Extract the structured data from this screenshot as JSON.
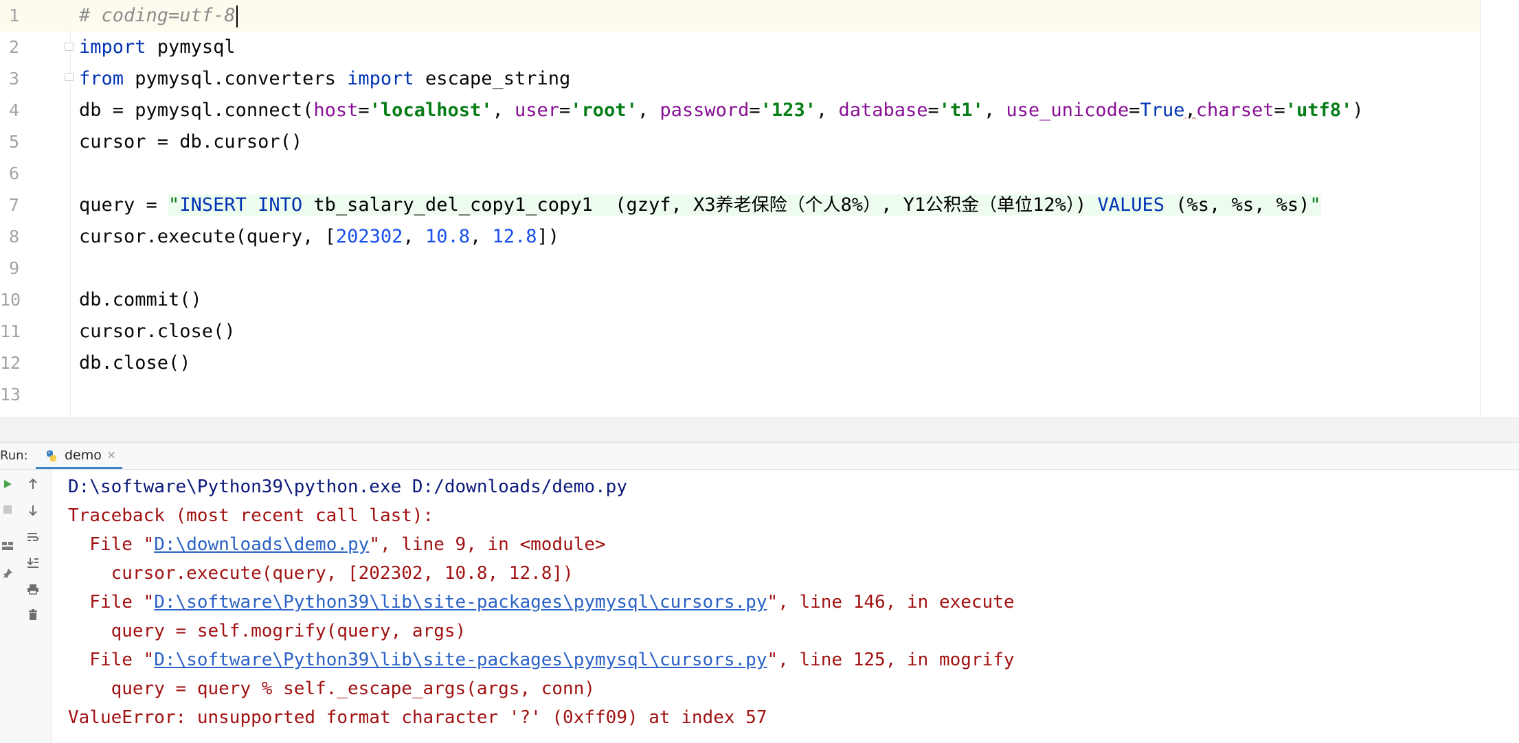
{
  "editor": {
    "lines": [
      {
        "no": "1",
        "comment": "# coding=utf-8"
      },
      {
        "no": "2",
        "kw": "import",
        "rest": " pymysql"
      },
      {
        "no": "3",
        "kw1": "from",
        "mid": " pymysql.converters ",
        "kw2": "import",
        "rest": " escape_string"
      },
      {
        "no": "4",
        "pre": "db = pymysql.connect(",
        "k_host": "host",
        "eq": "=",
        "v_host": "'localhost'",
        "sep": ", ",
        "k_user": "user",
        "v_user": "'root'",
        "k_password": "password",
        "v_password": "'123'",
        "k_database": "database",
        "v_database": "'t1'",
        "k_use_unicode": "use_unicode",
        "v_true": "True",
        "comma": ",",
        "k_charset": "charset",
        "v_charset": "'utf8'",
        "close": ")"
      },
      {
        "no": "5",
        "text": "cursor = db.cursor()"
      },
      {
        "no": "6",
        "text": ""
      },
      {
        "no": "7",
        "pre": "query = ",
        "q_open": "\"",
        "sql_insert": "INSERT INTO",
        "sql_table": " tb_salary_del_copy1_copy1  (gzyf, X3",
        "cjk1": "养老保险（个人",
        "mid1": "8%",
        "cjk2": "）",
        "mid2": ", Y1",
        "cjk3": "公积金（单位",
        "mid3": "12%",
        "cjk4": "）",
        "mid4": ") ",
        "sql_values": "VALUES",
        "tail": " (%s, %s, %s)",
        "q_close": "\""
      },
      {
        "no": "8",
        "pre": "cursor.execute(query, [",
        "n1": "202302",
        "c1": ", ",
        "n2": "10.8",
        "c2": ", ",
        "n3": "12.8",
        "post": "])"
      },
      {
        "no": "9",
        "text": ""
      },
      {
        "no": "10",
        "text": "db.commit()"
      },
      {
        "no": "11",
        "text": "cursor.close()"
      },
      {
        "no": "12",
        "text": "db.close()"
      },
      {
        "no": "13",
        "text": ""
      }
    ]
  },
  "run": {
    "label": "Run:",
    "tab": {
      "name": "demo",
      "close": "×"
    },
    "toolbar_icons": [
      "rerun-icon",
      "stop-icon",
      "layout-icon",
      "pin-icon",
      "up-arrow-icon",
      "down-arrow-icon",
      "soft-wrap-icon",
      "scroll-to-end-icon",
      "print-icon",
      "trash-icon"
    ],
    "output": {
      "cmd": "D:\\software\\Python39\\python.exe D:/downloads/demo.py",
      "tb_header": "Traceback (most recent call last):",
      "f1_pre": "  File \"",
      "f1_link": "D:\\downloads\\demo.py",
      "f1_post": "\", line 9, in <module>",
      "f1_code": "    cursor.execute(query, [202302, 10.8, 12.8])",
      "f2_pre": "  File \"",
      "f2_link": "D:\\software\\Python39\\lib\\site-packages\\pymysql\\cursors.py",
      "f2_post": "\", line 146, in execute",
      "f2_code": "    query = self.mogrify(query, args)",
      "f3_pre": "  File \"",
      "f3_link": "D:\\software\\Python39\\lib\\site-packages\\pymysql\\cursors.py",
      "f3_post": "\", line 125, in mogrify",
      "f3_code": "    query = query % self._escape_args(args, conn)",
      "error": "ValueError: unsupported format character '?' (0xff09) at index 57"
    }
  },
  "colors": {
    "keyword": "#0033b3",
    "string": "#067d17",
    "number": "#1750eb",
    "kwarg": "#871094",
    "comment": "#8c8c8c",
    "error_text": "#a11212",
    "link": "#2a62c5",
    "current_line": "#fdfbed",
    "injected_sql_bg": "#edfcef"
  }
}
